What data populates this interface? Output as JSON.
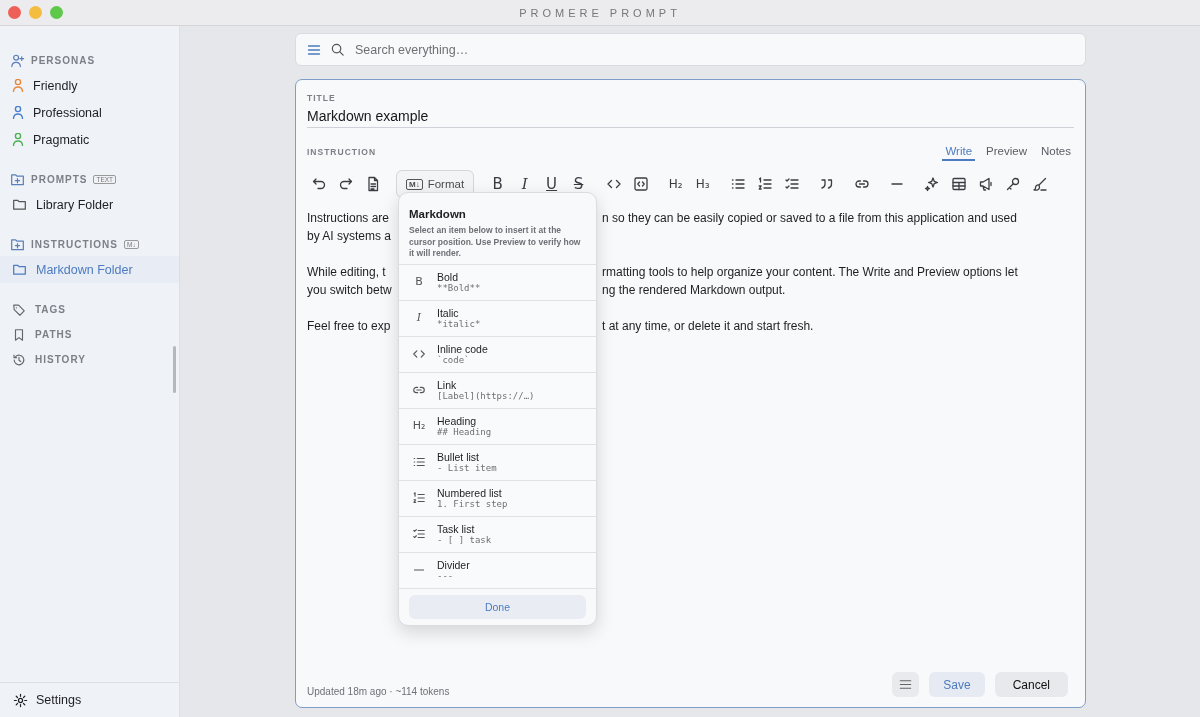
{
  "window": {
    "title": "PROMERE PROMPT"
  },
  "sidebar": {
    "sections": [
      {
        "kind": "personas",
        "title": "PERSONAS",
        "items": [
          {
            "label": "Friendly",
            "color": "#e8893a",
            "selected": false
          },
          {
            "label": "Professional",
            "color": "#4a7fd0",
            "selected": false
          },
          {
            "label": "Pragmatic",
            "color": "#4caf50",
            "selected": false
          }
        ]
      },
      {
        "kind": "folders",
        "title": "PROMPTS",
        "badge": "TEXT",
        "items": [
          {
            "label": "Library Folder",
            "selected": false
          }
        ]
      },
      {
        "kind": "folders",
        "title": "INSTRUCTIONS",
        "badge": "M↓",
        "items": [
          {
            "label": "Markdown Folder",
            "selected": true
          }
        ]
      }
    ],
    "links": [
      {
        "kind": "tag",
        "label": "TAGS"
      },
      {
        "kind": "bookmark",
        "label": "PATHS"
      },
      {
        "kind": "history",
        "label": "HISTORY"
      }
    ],
    "settings": "Settings"
  },
  "search": {
    "placeholder": "Search everything…"
  },
  "editor": {
    "title_label": "TITLE",
    "title_value": "Markdown example",
    "instruction_label": "INSTRUCTION",
    "tabs": [
      {
        "label": "Write",
        "selected": true
      },
      {
        "label": "Preview",
        "selected": false
      },
      {
        "label": "Notes",
        "selected": false
      }
    ],
    "toolbar": [
      [
        {
          "kind": "undo"
        },
        {
          "kind": "redo"
        },
        {
          "kind": "document"
        }
      ],
      [
        {
          "kind": "format",
          "badge": "M↓",
          "label": "Format"
        }
      ],
      [
        {
          "kind": "bold",
          "text": "B"
        },
        {
          "kind": "italic",
          "text": "I"
        },
        {
          "kind": "underline",
          "text": "U"
        },
        {
          "kind": "strike",
          "text": "S"
        }
      ],
      [
        {
          "kind": "code"
        },
        {
          "kind": "code-block"
        }
      ],
      [
        {
          "kind": "heading",
          "text": "H₂"
        },
        {
          "kind": "heading",
          "text": "H₃"
        }
      ],
      [
        {
          "kind": "bullet"
        },
        {
          "kind": "numbered"
        },
        {
          "kind": "task"
        }
      ],
      [
        {
          "kind": "quote"
        }
      ],
      [
        {
          "kind": "link"
        }
      ],
      [
        {
          "kind": "divider"
        }
      ],
      [
        {
          "kind": "sparkle"
        },
        {
          "kind": "table"
        },
        {
          "kind": "megaphone"
        },
        {
          "kind": "key"
        },
        {
          "kind": "brush"
        }
      ]
    ],
    "paragraphs": [
      [
        {
          "left": "Instructions are",
          "right": "n so they can be easily copied or saved to a file from this application and used"
        },
        {
          "left": "by AI systems a"
        }
      ],
      [
        {
          "left": "While editing, t",
          "right": "rmatting tools to help organize your content. The Write and Preview options let"
        },
        {
          "left": "you switch betw",
          "right": "ng the rendered Markdown output."
        }
      ],
      [
        {
          "left": "Feel free to exp",
          "right": "t at any time, or delete it and start fresh."
        }
      ]
    ],
    "footer": {
      "status": "Updated 18m ago · ~114 tokens",
      "save": "Save",
      "cancel": "Cancel"
    }
  },
  "format_menu": {
    "title": "Markdown",
    "description": "Select an item below to insert it at the cursor position. Use Preview to verify how it will render.",
    "items": [
      {
        "kind": "bold",
        "glyph": "B",
        "label": "Bold",
        "syntax": "**Bold**"
      },
      {
        "kind": "italic",
        "glyph": "I",
        "label": "Italic",
        "syntax": "*italic*"
      },
      {
        "kind": "code",
        "label": "Inline code",
        "syntax": "`code`"
      },
      {
        "kind": "link",
        "label": "Link",
        "syntax": "[Label](https://…)"
      },
      {
        "kind": "heading",
        "glyph": "H₂",
        "label": "Heading",
        "syntax": "## Heading"
      },
      {
        "kind": "bullet",
        "label": "Bullet list",
        "syntax": "- List item"
      },
      {
        "kind": "numbered",
        "label": "Numbered list",
        "syntax": "1. First step"
      },
      {
        "kind": "task",
        "label": "Task list",
        "syntax": "- [ ] task"
      },
      {
        "kind": "divider",
        "label": "Divider",
        "syntax": "---"
      }
    ],
    "done": "Done"
  }
}
